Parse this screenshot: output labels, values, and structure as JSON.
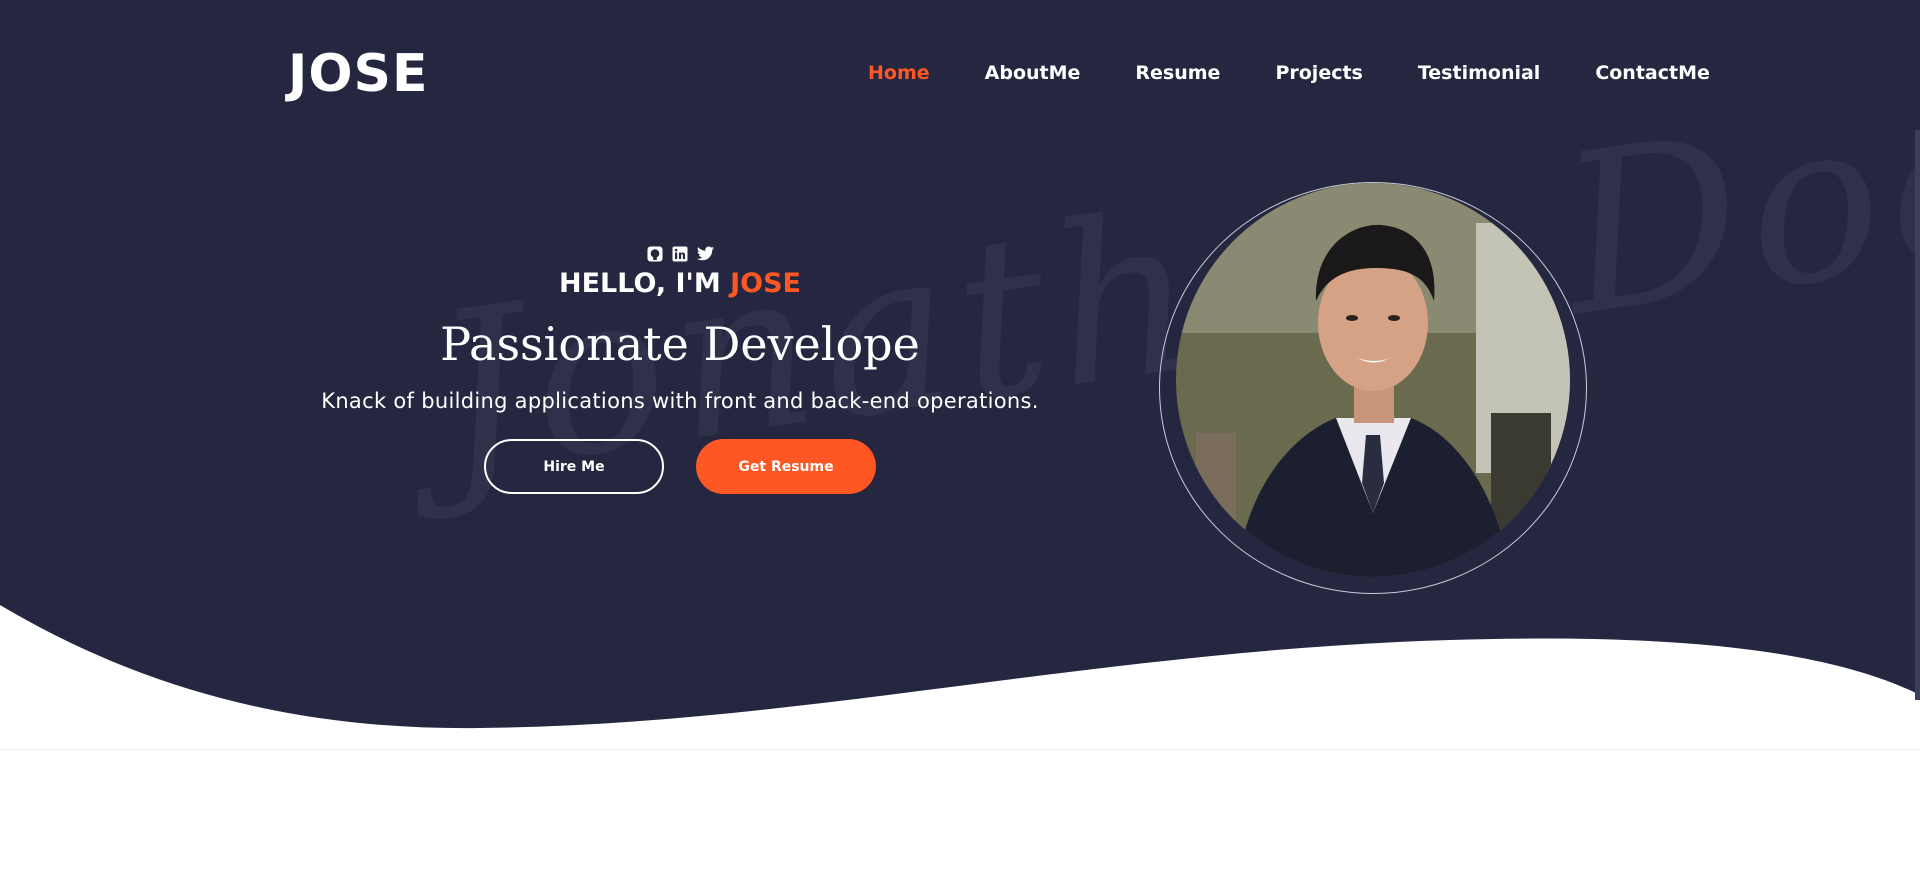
{
  "brand": {
    "logo": "JOSE"
  },
  "nav": {
    "items": [
      {
        "label": "Home",
        "active": true
      },
      {
        "label": "AboutMe",
        "active": false
      },
      {
        "label": "Resume",
        "active": false
      },
      {
        "label": "Projects",
        "active": false
      },
      {
        "label": "Testimonial",
        "active": false
      },
      {
        "label": "ContactMe",
        "active": false
      }
    ]
  },
  "hero": {
    "social_icons": [
      "github-icon",
      "linkedin-icon",
      "twitter-icon"
    ],
    "hello_prefix": "HELLO, I'M ",
    "hello_name": "JOSE",
    "tagline": "Passionate Develope",
    "description": "Knack of building applications with front and back-end operations.",
    "hire_label": "Hire Me",
    "resume_label": "Get Resume",
    "watermark": "Jonathan Doe",
    "photo": "profile-photo"
  },
  "colors": {
    "hero_bg": "#252740",
    "accent": "#ff5723",
    "text": "#ffffff"
  }
}
